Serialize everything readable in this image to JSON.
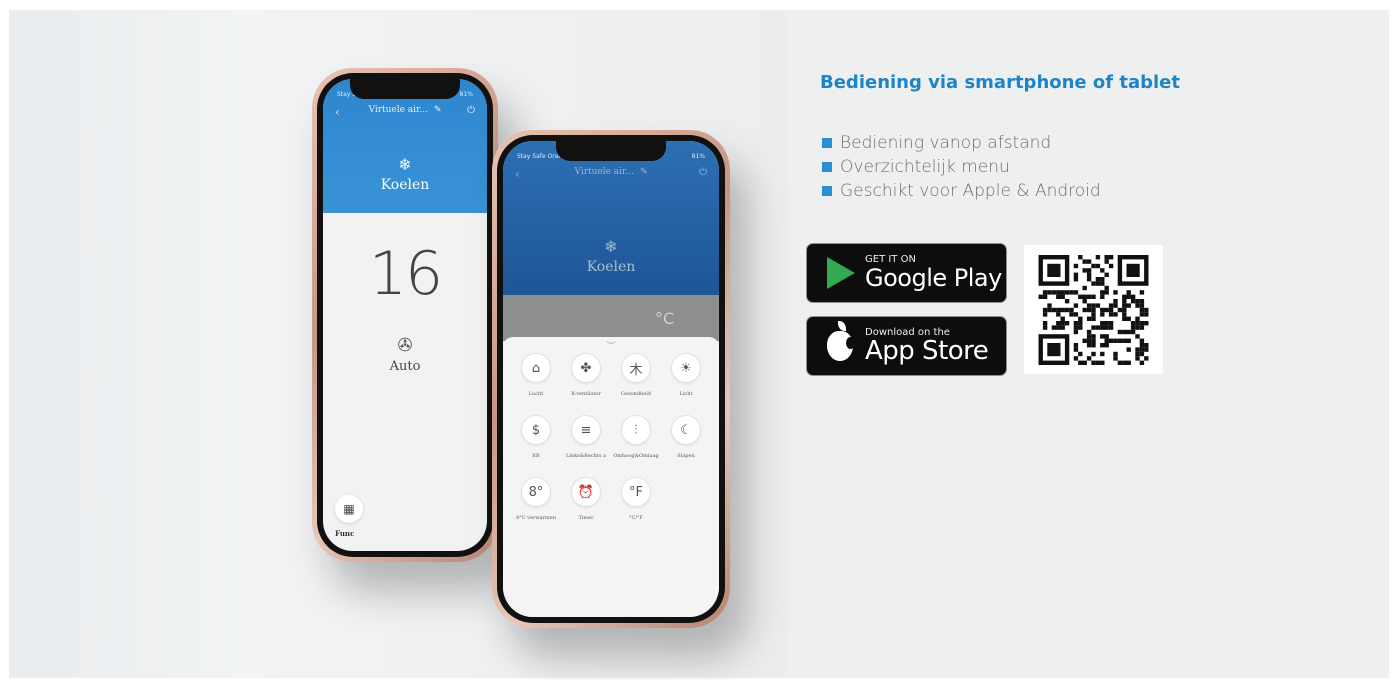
{
  "colors": {
    "accent": "#1f84c6",
    "bullet": "#2a8fd3",
    "app_blue": "#2e86cf",
    "app_dark_blue": "#1e5696"
  },
  "phone_back": {
    "status": "Stay Safe Orange B  4G  09:17",
    "battery": "81%",
    "title": "Virtuele air...",
    "back_icon": "chevron-left-icon",
    "power_icon": "power-icon",
    "mode": "Koelen",
    "temperature": "16",
    "fan_mode": "Auto",
    "func_label": "Func"
  },
  "phone_front": {
    "status": "Stay Safe Orange B  4G  09:18",
    "battery": "81%",
    "title": "Virtuele air...",
    "mode": "Koelen",
    "unit": "°C",
    "buttons": [
      {
        "label": "Lucht",
        "glyph": "⌂"
      },
      {
        "label": "X-ventilator",
        "glyph": "✤"
      },
      {
        "label": "Gezondheid",
        "glyph": "⽊"
      },
      {
        "label": "Licht",
        "glyph": "☀"
      },
      {
        "label": "EB",
        "glyph": "$"
      },
      {
        "label": "Links&Rechts a",
        "glyph": "≡"
      },
      {
        "label": "Omhoog&Omlaag",
        "glyph": "⫶"
      },
      {
        "label": "Slapen",
        "glyph": "☾"
      },
      {
        "label": "8°C verwarmen",
        "glyph": "8°"
      },
      {
        "label": "Timer",
        "glyph": "⏰"
      },
      {
        "label": "°C/°F",
        "glyph": "°F"
      }
    ]
  },
  "panel": {
    "heading": "Bediening via smartphone of tablet",
    "features": [
      "Bediening vanop afstand",
      "Overzichtelijk menu",
      "Geschikt voor Apple & Android"
    ]
  },
  "badges": {
    "google_small": "GET IT ON",
    "google_big": "Google Play",
    "apple_small": "Download on the",
    "apple_big": "App Store"
  }
}
